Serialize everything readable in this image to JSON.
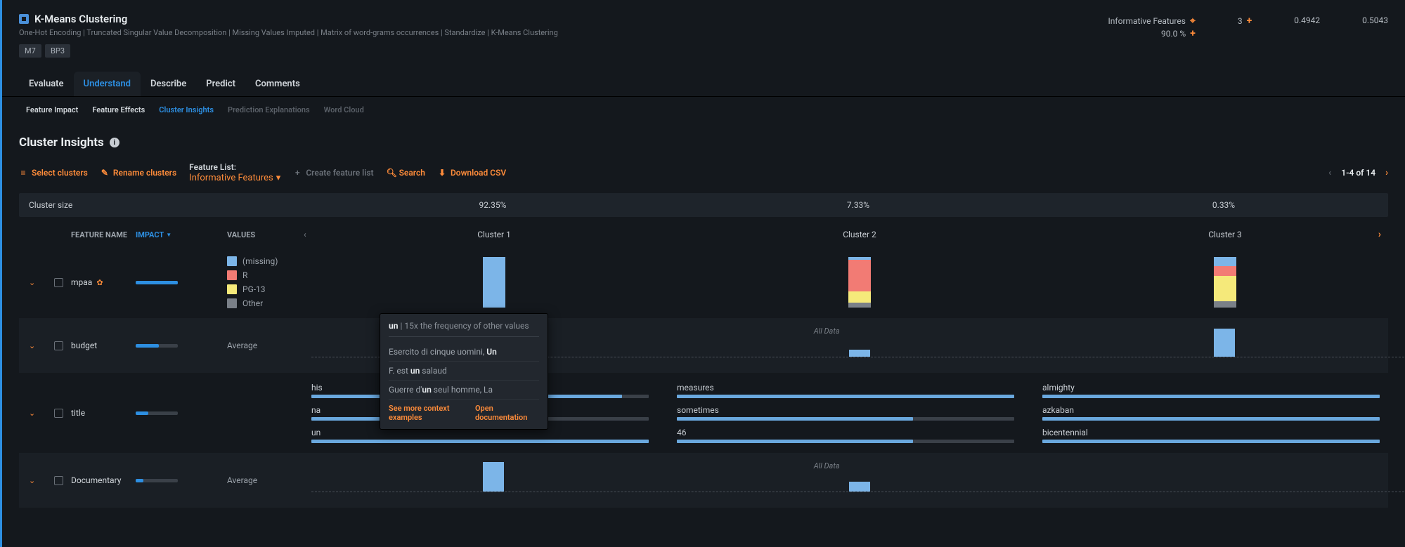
{
  "header": {
    "title": "K-Means Clustering",
    "subtitle": "One-Hot Encoding | Truncated Singular Value Decomposition | Missing Values Imputed | Matrix of word-grams occurrences | Standardize | K-Means Clustering",
    "badges": [
      "M7",
      "BP3"
    ],
    "metrics": {
      "feature_label": "Informative Features",
      "feature_pct": "90.0 %",
      "m2": "3",
      "m3": "0.4942",
      "m4": "0.5043"
    }
  },
  "tabs": {
    "main": [
      "Evaluate",
      "Understand",
      "Describe",
      "Predict",
      "Comments"
    ],
    "main_active": "Understand",
    "sub": [
      "Feature Impact",
      "Feature Effects",
      "Cluster Insights",
      "Prediction Explanations",
      "Word Cloud"
    ],
    "sub_active": "Cluster Insights"
  },
  "section": {
    "title": "Cluster Insights"
  },
  "toolbar": {
    "select": "Select clusters",
    "rename": "Rename clusters",
    "flist_label": "Feature List:",
    "flist_value": "Informative Features",
    "create": "Create feature list",
    "search": "Search",
    "download": "Download CSV",
    "paging": "1-4 of 14"
  },
  "grid": {
    "size_label": "Cluster size",
    "cols": {
      "feature": "FEATURE NAME",
      "impact": "IMPACT",
      "values": "VALUES"
    },
    "clusters": [
      {
        "name": "Cluster 1",
        "size": "92.35%"
      },
      {
        "name": "Cluster 2",
        "size": "7.33%"
      },
      {
        "name": "Cluster 3",
        "size": "0.33%"
      }
    ],
    "legend": {
      "missing": "(missing)",
      "r": "R",
      "pg13": "PG-13",
      "other": "Other"
    },
    "features": {
      "mpaa": "mpaa",
      "budget": "budget",
      "title": "title",
      "documentary": "Documentary",
      "avg": "Average",
      "alldata": "All Data"
    },
    "title_rows": {
      "c1": [
        "his",
        "na",
        "un"
      ],
      "c2": [
        "measures",
        "sometimes",
        "46"
      ],
      "c3": [
        "almighty",
        "azkaban",
        "bicentennial"
      ]
    }
  },
  "tooltip": {
    "word": "un",
    "freq": "15x the frequency of other values",
    "examples": [
      {
        "pre": "Esercito di cinque uomini, ",
        "b": "Un",
        "post": ""
      },
      {
        "pre": "F. est ",
        "b": "un",
        "post": " salaud"
      },
      {
        "pre": "Guerre d'",
        "b": "un",
        "post": " seul homme, La"
      }
    ],
    "link1": "See more context examples",
    "link2": "Open documentation"
  },
  "chart_data": {
    "type": "table",
    "features": [
      {
        "name": "mpaa",
        "impact": 100,
        "kind": "stacked-categorical",
        "categories": [
          "(missing)",
          "R",
          "PG-13",
          "Other"
        ],
        "clusters": {
          "Cluster 1": [
            100,
            0,
            0,
            0
          ],
          "Cluster 2": [
            6,
            62,
            22,
            10
          ],
          "Cluster 3": [
            18,
            20,
            50,
            12
          ]
        }
      },
      {
        "name": "budget",
        "impact": 55,
        "kind": "numeric-vs-alldata",
        "baseline_label": "All Data",
        "clusters": {
          "Cluster 1": 0,
          "Cluster 2": 0.25,
          "Cluster 3": 1.0
        }
      },
      {
        "name": "title",
        "impact": 30,
        "kind": "text-tokens",
        "clusters": {
          "Cluster 1": [
            {
              "token": "his",
              "rel": 0.92
            },
            {
              "token": "na",
              "rel": 0.55
            },
            {
              "token": "un",
              "rel": 1.0
            }
          ],
          "Cluster 2": [
            {
              "token": "measures",
              "rel": 1.0
            },
            {
              "token": "sometimes",
              "rel": 0.7
            },
            {
              "token": "46",
              "rel": 0.7
            }
          ],
          "Cluster 3": [
            {
              "token": "almighty",
              "rel": 1.0
            },
            {
              "token": "azkaban",
              "rel": 1.0
            },
            {
              "token": "bicentennial",
              "rel": 1.0
            }
          ]
        }
      },
      {
        "name": "Documentary",
        "impact": 18,
        "kind": "numeric-vs-alldata",
        "baseline_label": "All Data",
        "clusters": {
          "Cluster 1": 1.0,
          "Cluster 2": 0.35,
          "Cluster 3": 0
        }
      }
    ]
  }
}
